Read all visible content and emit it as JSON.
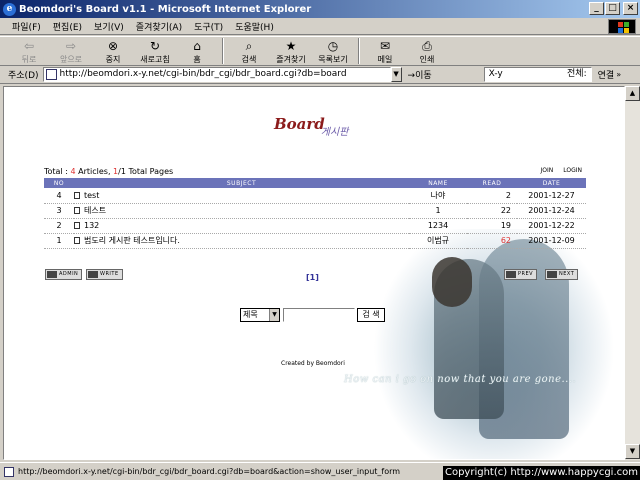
{
  "window": {
    "title": "Beomdori's Board v1.1 - Microsoft Internet Explorer"
  },
  "menu": [
    "파일(F)",
    "편집(E)",
    "보기(V)",
    "즐겨찾기(A)",
    "도구(T)",
    "도움말(H)"
  ],
  "toolbar": {
    "back": "뒤로",
    "forward": "앞으로",
    "stop": "중지",
    "refresh": "새로고침",
    "home": "홈",
    "search": "검색",
    "favorites": "즐겨찾기",
    "history": "목록보기",
    "mail": "메일",
    "print": "인쇄"
  },
  "address": {
    "label": "주소(D)",
    "url": "http://beomdori.x-y.net/cgi-bin/bdr_cgi/bdr_board.cgi?db=board",
    "go": "이동",
    "search_value": "X-y",
    "search_scope": "전체:",
    "links": "연결"
  },
  "board": {
    "logo": "Board",
    "logo_kr": "게시판",
    "total_label": "Total : ",
    "total_articles": "4",
    "articles_word": " Articles, ",
    "page_cur": "1",
    "page_total": "/1 Total Pages",
    "join": "JOIN",
    "login": "LOGIN",
    "headers": [
      "NO",
      "SUBJECT",
      "NAME",
      "READ",
      "DATE"
    ],
    "rows": [
      {
        "no": "4",
        "subject": "test",
        "name": "나야",
        "read": "2",
        "date": "2001-12-27"
      },
      {
        "no": "3",
        "subject": "테스트",
        "name": "1",
        "read": "22",
        "date": "2001-12-24"
      },
      {
        "no": "2",
        "subject": "132",
        "name": "1234",
        "read": "19",
        "date": "2001-12-22"
      },
      {
        "no": "1",
        "subject": "범도리 게시판 테스트입니다.",
        "name": "이범규",
        "read": "62",
        "date": "2001-12-09"
      }
    ],
    "admin": "ADMIN",
    "write": "WRITE",
    "prev": "PREV",
    "next": "NEXT",
    "pager": "[1]",
    "search_select": "제목",
    "search_button": "검 색",
    "created_by": "Created by Beomdori",
    "lyric": "How can i go on now that you are gone...."
  },
  "status": {
    "text": "http://beomdori.x-y.net/cgi-bin/bdr_cgi/bdr_board.cgi?db=board&action=show_user_input_form",
    "copyright": "Copyright(c) http://www.happycgi.com"
  }
}
